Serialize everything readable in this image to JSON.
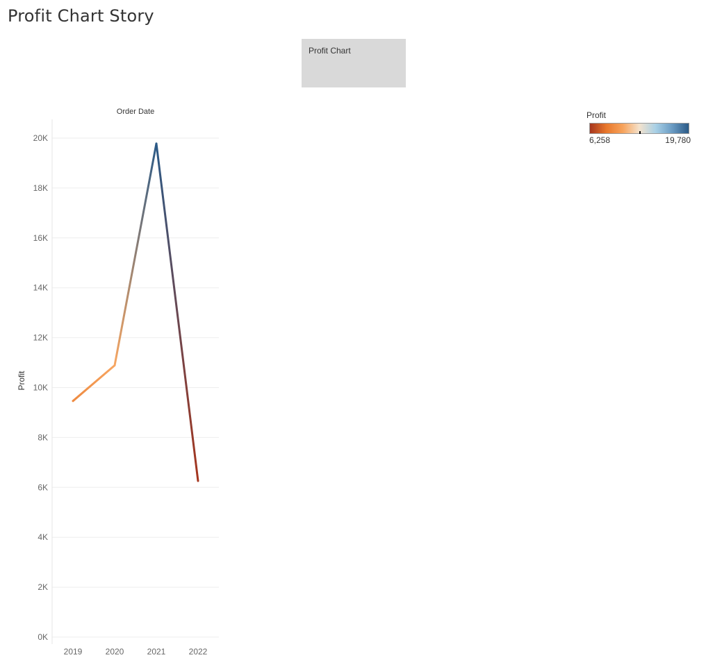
{
  "story": {
    "title": "Profit Chart Story",
    "story_point_label": "Profit Chart"
  },
  "legend": {
    "title": "Profit",
    "min_label": "6,258",
    "max_label": "19,780",
    "colors": [
      "#a6361e",
      "#e8782c",
      "#f7a35c",
      "#f4e2cc",
      "#a8d0e6",
      "#6a9bc3",
      "#2b5a87"
    ]
  },
  "chart_data": {
    "type": "line",
    "title": "",
    "column_header": "Order Date",
    "ylabel": "Profit",
    "xlabel": "",
    "categories": [
      "2019",
      "2020",
      "2021",
      "2022"
    ],
    "series": [
      {
        "values": [
          9463,
          10890,
          19780,
          6258
        ]
      }
    ],
    "ylim": [
      0,
      20000
    ],
    "yticks": [
      0,
      2000,
      4000,
      6000,
      8000,
      10000,
      12000,
      14000,
      16000,
      18000,
      20000
    ],
    "ytick_labels": [
      "0K",
      "2K",
      "4K",
      "6K",
      "8K",
      "10K",
      "12K",
      "14K",
      "16K",
      "18K",
      "20K"
    ],
    "grid": true,
    "color_range": [
      6258,
      19780
    ]
  }
}
